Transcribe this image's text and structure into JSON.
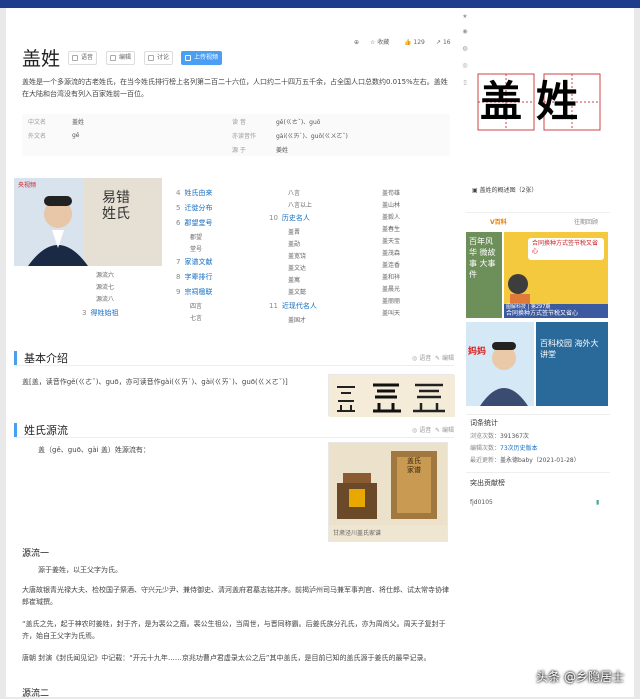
{
  "title": "盖姓",
  "toolbar": {
    "voice": "语音",
    "edit": "编辑",
    "discuss": "讨论",
    "upload": "上传视频",
    "collect": "收藏",
    "likes": "129",
    "shares": "16"
  },
  "summary": [
    "盖姓是一个多源流的古老姓氏，在当今姓氏排行榜上名列第二百二十六位，人口约二十四万五千余，占全国人口总数约0.015%左右。盖姓在大陆和台湾没有列入百家姓前一百位。"
  ],
  "basic_info": [
    {
      "k1": "中文名",
      "v1": "盖姓",
      "k2": "读    音",
      "v2": "gě(ㄍㄜˇ)、guō"
    },
    {
      "k1": "外文名",
      "v1": "gě",
      "k2": "亦读音作",
      "v2": "gài(ㄍㄞˋ)、guō(ㄍㄨㄛˇ)"
    },
    {
      "k1": "",
      "v1": "",
      "k2": "源    于",
      "v2": "姜姓"
    }
  ],
  "video": {
    "logo": "央视频",
    "text": "易错姓氏"
  },
  "toc": {
    "col1": [
      {
        "num": "4",
        "label": "姓氏由来"
      },
      {
        "num": "5",
        "label": "迁徙分布"
      },
      {
        "num": "6",
        "label": "郡望堂号"
      },
      {
        "num": "",
        "label": "郡望"
      },
      {
        "num": "",
        "label": "堂号"
      },
      {
        "num": "7",
        "label": "家谱文献"
      },
      {
        "num": "8",
        "label": "字辈排行"
      },
      {
        "num": "9",
        "label": "宗祠楹联"
      },
      {
        "num": "",
        "label": "四言"
      },
      {
        "num": "",
        "label": "七言"
      }
    ],
    "col0": [
      "源流六",
      "源流七",
      "源流八"
    ],
    "col0_last": {
      "num": "3",
      "label": "得姓始祖"
    },
    "col2": [
      {
        "num": "",
        "label": "八言"
      },
      {
        "num": "",
        "label": "八言以上"
      },
      {
        "num": "10",
        "label": "历史名人"
      },
      {
        "num": "",
        "label": "盖晋"
      },
      {
        "num": "",
        "label": "盖勋"
      },
      {
        "num": "",
        "label": "盖宽饶"
      },
      {
        "num": "",
        "label": "盖文达"
      },
      {
        "num": "",
        "label": "盖寓"
      },
      {
        "num": "",
        "label": "盖文懿"
      },
      {
        "num": "11",
        "label": "近现代名人"
      },
      {
        "num": "",
        "label": "盖国才"
      }
    ],
    "col3": [
      "盖苟雄",
      "盖山林",
      "盖毅人",
      "盖春生",
      "盖天宝",
      "盖茂森",
      "盖连香",
      "盖和祥",
      "盖晨光",
      "盖丽丽",
      "盖叫天"
    ]
  },
  "sections": {
    "intro": {
      "title": "基本介绍",
      "voice": "语音",
      "edit": "编辑",
      "text": "盖[盖，读音作gě(ㄍㄜˇ)、guō，亦可读音作gài(ㄍㄞˋ)、gài(ㄍㄞˋ)、guō(ㄍㄨㄛˇ)]"
    },
    "origin": {
      "title": "姓氏源流",
      "voice": "语音",
      "edit": "编辑",
      "text": "盖（gě、guō、gài 盖）姓源流有：",
      "img_caption": "甘肃泾川盖氏家谱",
      "book_title": "盖氏家谱"
    },
    "src1": {
      "title": "源流一",
      "p1": "源于姜姓，以王父字为氏。",
      "p2": "大唐故银青光禄大夫、检校国子祭酒、守兴元少尹、兼侍御史、清河盖府君墓志铭并序。前揭泸州司马兼军事判官、将仕郎、试太常寺协律郎崔瑊撰。",
      "p3": "“盖氏之先，起于神农时姜姓，封于齐，是为裴公之裔。裴公生祖公，当周世，与晋同称霸。后姜氏族分孔氏，亦为周尚父。周天子复封于齐，始自王父字为氏焉。",
      "p4": "唐朝 封演《封氏闻见记》中记载：“开元十九年……京兆功曹卢君虚录太公之后”其中盖氏，是目前已知的盖氏源于姜氏的最早记录。"
    },
    "src2": {
      "title": "源流二"
    }
  },
  "right": {
    "calligraphy": "盖姓",
    "overview": "盖姓的概述图（2张）",
    "vbaike": {
      "brand": "V百科",
      "more": "往期回顾",
      "promo": "百年风华 微故事 大事件",
      "card_title": "合同换种方式签节税又省心",
      "card_sub": "图解科技 | 第297期",
      "card_sub2": "合同换种方式签节税又省心",
      "card2_left": "妈妈",
      "card2_right": "百科校园 海外大讲堂"
    },
    "stats": {
      "title": "词条统计",
      "rows": [
        {
          "k": "浏览次数：",
          "v": "391367次"
        },
        {
          "k": "编辑次数：",
          "v": "73次历史版本"
        },
        {
          "k": "最近更新：",
          "v": "盖永德baby（2021-01-28）"
        }
      ],
      "contrib_title": "突出贡献榜",
      "contrib": "fjd0105"
    }
  },
  "watermark": "头条 @乡隐居士",
  "colors": {
    "link": "#136ec2",
    "accent": "#4b9ff2",
    "topbar": "#1f3d8c"
  }
}
